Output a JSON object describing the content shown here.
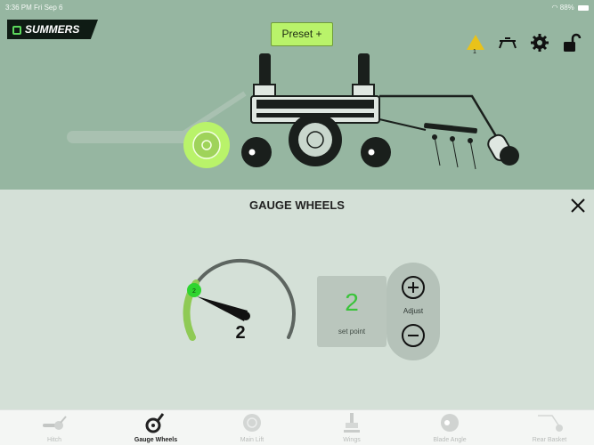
{
  "status": {
    "time": "3:36 PM  Fri Sep 6",
    "battery": "88%"
  },
  "header": {
    "brand": "SUMMERS",
    "preset_label": "Preset +",
    "warning_count": "1"
  },
  "icons": [
    "warning-icon",
    "hitch-icon",
    "gear-icon",
    "unlock-icon",
    "close-icon",
    "plus-icon",
    "minus-icon"
  ],
  "panel": {
    "title": "GAUGE WHEELS",
    "gauge_value": "2",
    "gauge_indicator": "2",
    "set_point_value": "2",
    "set_point_label": "set point",
    "adjust_label": "Adjust"
  },
  "tabs": [
    {
      "label": "Hitch",
      "active": false
    },
    {
      "label": "Gauge Wheels",
      "active": true
    },
    {
      "label": "Main Lift",
      "active": false
    },
    {
      "label": "Wings",
      "active": false
    },
    {
      "label": "Blade Angle",
      "active": false
    },
    {
      "label": "Rear Basket",
      "active": false
    }
  ],
  "colors": {
    "top_bg": "#96b6a1",
    "panel_bg": "#d4e0d7",
    "accent_green": "#3ac33a",
    "preset_bg": "#b9f36a",
    "warning": "#e9c21a"
  }
}
